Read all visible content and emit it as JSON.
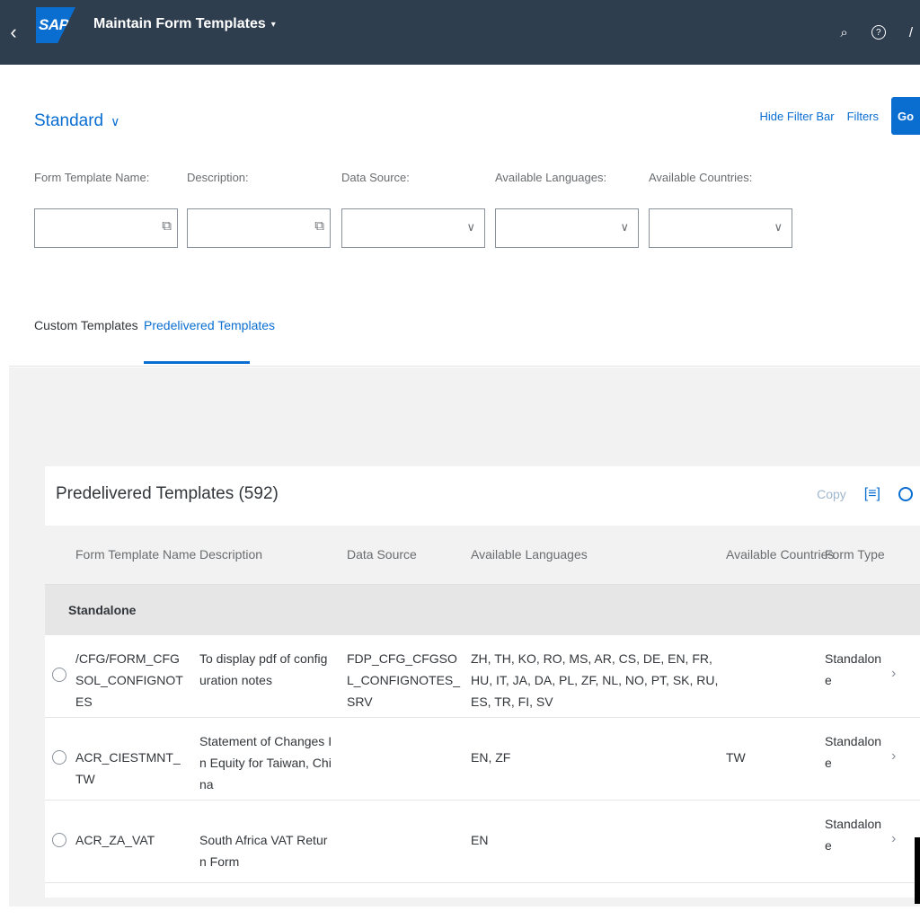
{
  "shell": {
    "back_icon": "chevron-left-icon",
    "logo_text": "SAP",
    "title": "Maintain Form Templates",
    "title_caret": "▾",
    "search_icon": "search-icon",
    "help_icon": "help-icon",
    "help_glyph": "?"
  },
  "filterbar": {
    "variant": "Standard",
    "variant_chevron": "∨",
    "hide_filter_bar": "Hide Filter Bar",
    "filters": "Filters",
    "go": "Go",
    "fields": [
      {
        "label": "Form Template Name:",
        "type": "valuehelp",
        "value": ""
      },
      {
        "label": "Description:",
        "type": "valuehelp",
        "value": ""
      },
      {
        "label": "Data Source:",
        "type": "dropdown",
        "value": ""
      },
      {
        "label": "Available Languages:",
        "type": "dropdown",
        "value": ""
      },
      {
        "label": "Available Countries:",
        "type": "dropdown",
        "value": ""
      }
    ]
  },
  "tabs": [
    {
      "label": "Custom Templates",
      "selected": false
    },
    {
      "label": "Predelivered Templates",
      "selected": true
    }
  ],
  "table": {
    "title": "Predelivered Templates (592)",
    "copy_label": "Copy",
    "columns": [
      "Form Template Name",
      "Description",
      "Data Source",
      "Available Languages",
      "Available Countries",
      "Form Type"
    ],
    "group": "Standalone",
    "rows": [
      {
        "name": "/CFG/FORM_CFGSOL_CONFIGNOTES",
        "description": "To display pdf of configuration notes",
        "data_source": "FDP_CFG_CFGSOL_CONFIGNOTES_SRV",
        "languages": "ZH, TH, KO, RO, MS, AR, CS, DE, EN, FR, HU, IT, JA, DA, PL, ZF, NL, NO, PT, SK, RU, ES, TR, FI, SV",
        "countries": "",
        "form_type": "Standalone"
      },
      {
        "name": "ACR_CIESTMNT_TW",
        "description": "Statement of Changes In Equity for Taiwan, China",
        "data_source": "",
        "languages": "EN, ZF",
        "countries": "TW",
        "form_type": "Standalone"
      },
      {
        "name": "ACR_ZA_VAT",
        "description": "South Africa VAT Return Form",
        "data_source": "",
        "languages": "EN",
        "countries": "",
        "form_type": "Standalone"
      }
    ]
  },
  "colors": {
    "shell_bg": "#2f3e4f",
    "accent": "#0a6ed1",
    "content_bg": "#f2f2f2"
  }
}
